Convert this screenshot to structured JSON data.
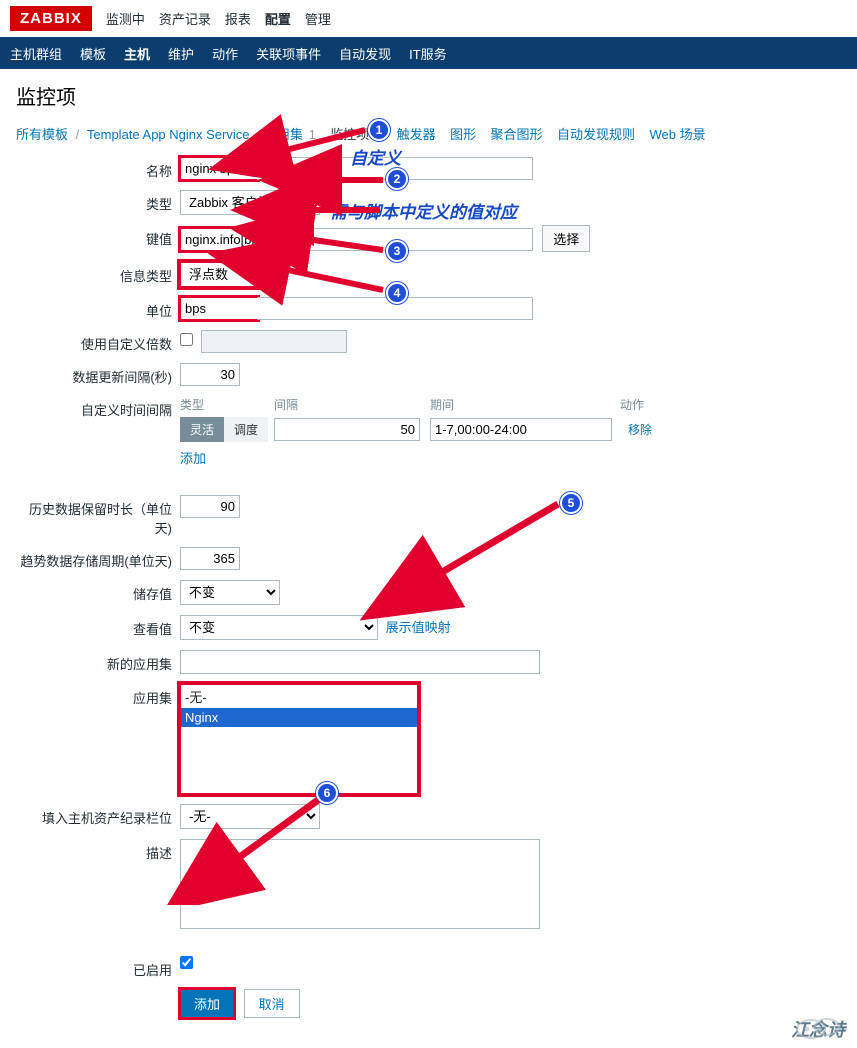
{
  "logo": "ZABBIX",
  "topnav": {
    "items": [
      "监测中",
      "资产记录",
      "报表",
      "配置",
      "管理"
    ],
    "active_index": 3
  },
  "subnav": {
    "items": [
      "主机群组",
      "模板",
      "主机",
      "维护",
      "动作",
      "关联项事件",
      "自动发现",
      "IT服务"
    ],
    "active_index": 2
  },
  "page_title": "监控项",
  "breadcrumb": {
    "all_templates": "所有模板",
    "template_name": "Template App Nginx Service",
    "tabs": [
      {
        "label": "应用集",
        "count": "1"
      },
      {
        "label": "监控项",
        "count": "6",
        "active": true
      },
      {
        "label": "触发器",
        "count": ""
      },
      {
        "label": "图形",
        "count": ""
      },
      {
        "label": "聚合图形",
        "count": ""
      },
      {
        "label": "自动发现规则",
        "count": ""
      },
      {
        "label": "Web 场景",
        "count": ""
      }
    ]
  },
  "form": {
    "name_label": "名称",
    "name_value": "nginx bps",
    "type_label": "类型",
    "type_value": "Zabbix 客户端",
    "key_label": "键值",
    "key_value": "nginx.info[bps]",
    "key_select_btn": "选择",
    "info_type_label": "信息类型",
    "info_type_value": "浮点数",
    "unit_label": "单位",
    "unit_value": "bps",
    "custom_multiplier_label": "使用自定义倍数",
    "update_interval_label": "数据更新间隔(秒)",
    "update_interval_value": "30",
    "custom_intervals_label": "自定义时间间隔",
    "interval_header": {
      "type": "类型",
      "interval": "间隔",
      "period": "期间",
      "action": "动作"
    },
    "interval_row": {
      "toggle_on": "灵活",
      "toggle_off": "调度",
      "interval_value": "50",
      "period_value": "1-7,00:00-24:00",
      "remove": "移除"
    },
    "interval_add": "添加",
    "history_label": "历史数据保留时长（单位天)",
    "history_value": "90",
    "trends_label": "趋势数据存储周期(单位天)",
    "trends_value": "365",
    "store_value_label": "储存值",
    "store_value_value": "不变",
    "show_value_label": "查看值",
    "show_value_value": "不变",
    "show_value_link": "展示值映射",
    "new_appset_label": "新的应用集",
    "appset_label": "应用集",
    "appset_options": [
      "-无-",
      "Nginx"
    ],
    "appset_selected_index": 1,
    "inventory_label": "填入主机资产纪录栏位",
    "inventory_value": "-无-",
    "description_label": "描述",
    "enabled_label": "已启用",
    "enabled_checked": true,
    "add_btn": "添加",
    "cancel_btn": "取消"
  },
  "annotations": {
    "text1": "自定义",
    "text2": "需与脚本中定义的值对应",
    "watermark": "江念诗"
  }
}
